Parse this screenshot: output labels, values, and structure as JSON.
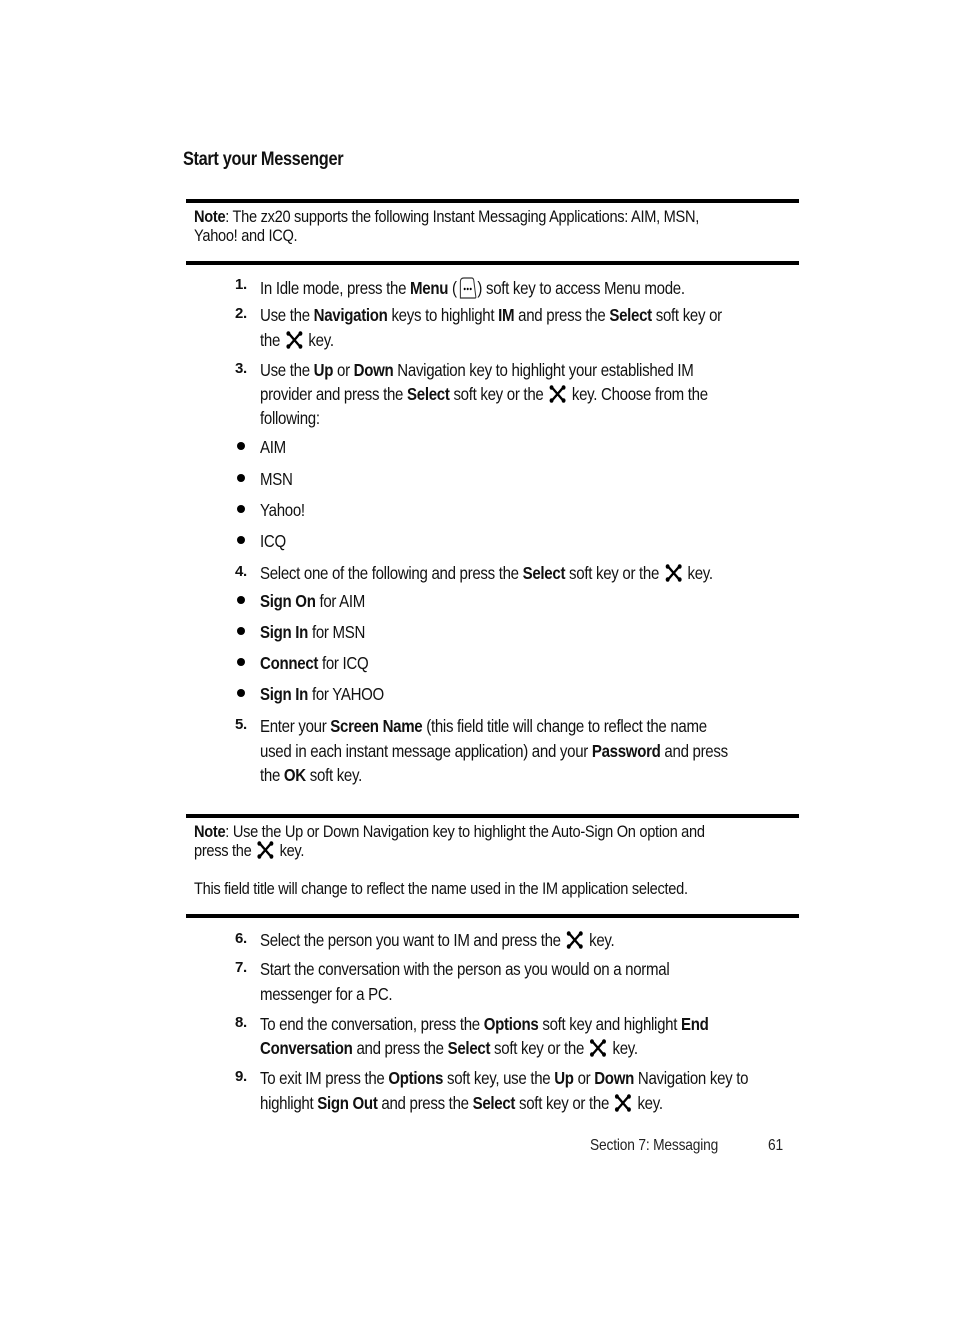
{
  "section": {
    "title": "Start your Messenger"
  },
  "note1": {
    "label": "Note",
    "line1": ": The zx20 supports the following Instant Messaging Applications: AIM, MSN,",
    "line2": "Yahoo! and ICQ."
  },
  "icons": {
    "menu_key": "menu-soft-key-icon",
    "select_key": "select-key-icon"
  },
  "steps": [
    {
      "number": "1.",
      "lines": [
        {
          "t1": "In Idle mode, press the ",
          "b1": "Menu",
          "t2": " (",
          "t3": ") soft key to access Menu mode."
        }
      ]
    },
    {
      "number": "2.",
      "lines": [
        {
          "t1": "Use the ",
          "b1": "Navigation",
          "t2": " keys to highlight ",
          "b2": "IM",
          "t3": " and press the ",
          "b3": "Select",
          "t4": " soft key or"
        },
        {
          "t1": "the ",
          "t2": " key."
        }
      ]
    },
    {
      "number": "3.",
      "lines": [
        {
          "t1": "Use the ",
          "b1": "Up",
          "t2": " or ",
          "b2": "Down",
          "t3": " Navigation key to highlight your established IM"
        },
        {
          "t1": "provider and press the ",
          "b1": "Select",
          "t2": " soft key or the ",
          "t3": " key. Choose from the"
        },
        {
          "t1": "following:"
        }
      ],
      "bullets": [
        "AIM",
        "MSN",
        "Yahoo!",
        "ICQ"
      ]
    },
    {
      "number": "4.",
      "lines": [
        {
          "t1": "Select one of the following and press the ",
          "b1": "Select",
          "t2": " soft key or the ",
          "t3": " key."
        }
      ],
      "bullets": [
        {
          "bold": "Sign On",
          "rest": " for AIM"
        },
        {
          "bold": "Sign In",
          "rest": " for MSN"
        },
        {
          "bold": "Connect",
          "rest": " for ICQ"
        },
        {
          "bold": "Sign In",
          "rest": " for YAHOO"
        }
      ]
    },
    {
      "number": "5.",
      "lines": [
        {
          "t1": "Enter your ",
          "b1": "Screen Name",
          "t2": " (this field title will change to reflect the name"
        },
        {
          "t1": "used in each instant message application) and your ",
          "b1": "Password",
          "t2": " and press"
        },
        {
          "t1": "the ",
          "b1": "OK",
          "t2": " soft key."
        }
      ]
    },
    {
      "number": "6.",
      "lines": [
        {
          "t1": "Select the person you want to IM and press the ",
          "t2": " key."
        }
      ]
    },
    {
      "number": "7.",
      "lines": [
        {
          "t1": "Start the conversation with the person as you would on a normal"
        },
        {
          "t1": "messenger for a PC."
        }
      ]
    },
    {
      "number": "8.",
      "lines": [
        {
          "t1": "To end the conversation, press the ",
          "b1": "Options",
          "t2": " soft key and highlight ",
          "b2": "End"
        },
        {
          "b1": "Conversation",
          "t1": " and press the ",
          "b2": "Select",
          "t2": " soft key or the ",
          "t3": " key."
        }
      ]
    },
    {
      "number": "9.",
      "lines": [
        {
          "t1": "To exit IM press the ",
          "b1": "Options",
          "t2": " soft key, use the ",
          "b2": "Up",
          "t3": " or ",
          "b3": "Down",
          "t4": " Navigation key to"
        },
        {
          "t1": "highlight ",
          "b1": "Sign Out",
          "t2": " and press the ",
          "b2": "Select",
          "t3": " soft key or the ",
          "t4": " key."
        }
      ]
    }
  ],
  "note2": {
    "label": "Note",
    "line1": ": Use the Up or Down Navigation key to highlight the Auto-Sign On option and",
    "line2a": "press the ",
    "line2b": " key.",
    "line3": "This field title will change to reflect the name used in the IM application selected."
  },
  "footer": {
    "section": "Section 7: Messaging",
    "page": "61"
  }
}
